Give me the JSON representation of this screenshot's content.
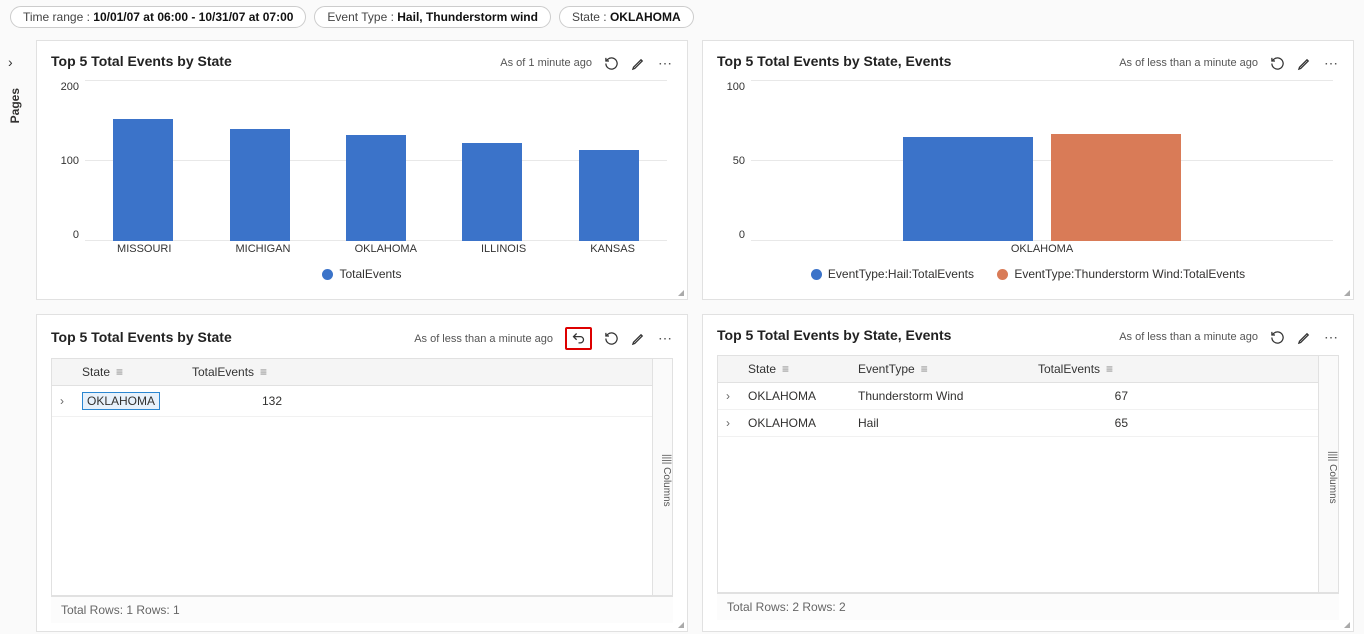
{
  "filters": {
    "time_label": "Time range :",
    "time_value": "10/01/07 at 06:00 - 10/31/07 at 07:00",
    "event_label": "Event Type :",
    "event_value": "Hail, Thunderstorm wind",
    "state_label": "State :",
    "state_value": "OKLAHOMA"
  },
  "sidebar": {
    "pages": "Pages"
  },
  "tiles": {
    "t1": {
      "title": "Top 5 Total Events by State",
      "asof": "As of 1 minute ago",
      "legend": "TotalEvents"
    },
    "t2": {
      "title": "Top 5 Total Events by State, Events",
      "asof": "As of less than a minute ago",
      "legend_a": "EventType:Hail:TotalEvents",
      "legend_b": "EventType:Thunderstorm Wind:TotalEvents"
    },
    "t3": {
      "title": "Top 5 Total Events by State",
      "asof": "As of less than a minute ago",
      "col_state": "State",
      "col_total": "TotalEvents",
      "row_state": "OKLAHOMA",
      "row_total": "132",
      "footer": "Total Rows: 1   Rows: 1",
      "columns": "Columns"
    },
    "t4": {
      "title": "Top 5 Total Events by State, Events",
      "asof": "As of less than a minute ago",
      "col_state": "State",
      "col_evtype": "EventType",
      "col_total": "TotalEvents",
      "r1_state": "OKLAHOMA",
      "r1_ev": "Thunderstorm Wind",
      "r1_tot": "67",
      "r2_state": "OKLAHOMA",
      "r2_ev": "Hail",
      "r2_tot": "65",
      "footer": "Total Rows: 2   Rows: 2",
      "columns": "Columns"
    }
  },
  "chart_data": [
    {
      "type": "bar",
      "title": "Top 5 Total Events by State",
      "categories": [
        "MISSOURI",
        "MICHIGAN",
        "OKLAHOMA",
        "ILLINOIS",
        "KANSAS"
      ],
      "series": [
        {
          "name": "TotalEvents",
          "values": [
            152,
            140,
            132,
            122,
            114
          ],
          "color": "#3b73c9"
        }
      ],
      "ylim": [
        0,
        200
      ],
      "yticks": [
        0,
        100,
        200
      ]
    },
    {
      "type": "bar",
      "title": "Top 5 Total Events by State, Events",
      "categories": [
        "OKLAHOMA"
      ],
      "series": [
        {
          "name": "EventType:Hail:TotalEvents",
          "values": [
            65
          ],
          "color": "#3b73c9"
        },
        {
          "name": "EventType:Thunderstorm Wind:TotalEvents",
          "values": [
            67
          ],
          "color": "#d97b57"
        }
      ],
      "ylim": [
        0,
        100
      ],
      "yticks": [
        0,
        50,
        100
      ]
    }
  ],
  "colors": {
    "blue": "#3b73c9",
    "orange": "#d97b57"
  }
}
